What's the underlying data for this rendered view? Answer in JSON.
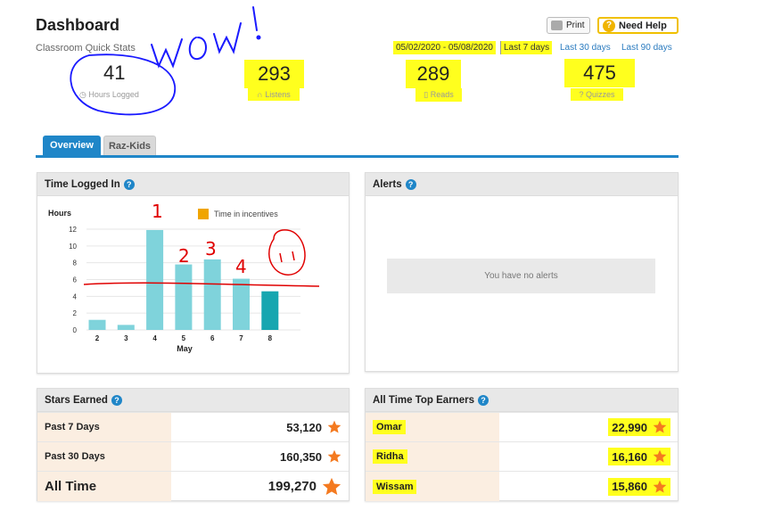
{
  "header": {
    "title": "Dashboard",
    "subtitle": "Classroom Quick Stats",
    "print_label": "Print",
    "help_label": "Need Help",
    "date_range": "05/02/2020 - 05/08/2020",
    "range_options": [
      "Last 7 days",
      "Last 30 days",
      "Last 90 days"
    ]
  },
  "stats": [
    {
      "value": "41",
      "label": "Hours Logged",
      "icon": "clock-icon"
    },
    {
      "value": "293",
      "label": "Listens",
      "icon": "headphones-icon"
    },
    {
      "value": "289",
      "label": "Reads",
      "icon": "book-icon"
    },
    {
      "value": "475",
      "label": "Quizzes",
      "icon": "question-icon"
    }
  ],
  "tabs": [
    "Overview",
    "Raz-Kids"
  ],
  "time_panel": {
    "title": "Time Logged In"
  },
  "chart_data": {
    "type": "bar",
    "ylabel": "Hours",
    "xlabel": "May",
    "categories": [
      "2",
      "3",
      "4",
      "5",
      "6",
      "7",
      "8"
    ],
    "values": [
      1.2,
      0.6,
      11.9,
      7.8,
      8.4,
      6.1,
      4.6
    ],
    "highlight_index": 6,
    "yticks": [
      0,
      2,
      4,
      6,
      8,
      10,
      12
    ],
    "ylim": [
      0,
      12
    ],
    "legend": "Time in incentives",
    "colors": {
      "bar": "#7fd3db",
      "highlight": "#17a6b0",
      "legend": "#f0a500"
    }
  },
  "annotations": {
    "wow_text": "WOW!",
    "bar_numbers": [
      "1",
      "2",
      "3",
      "4"
    ]
  },
  "alerts_panel": {
    "title": "Alerts",
    "empty_text": "You have no alerts"
  },
  "stars_panel": {
    "title": "Stars Earned",
    "rows": [
      {
        "label": "Past 7 Days",
        "value": "53,120"
      },
      {
        "label": "Past 30 Days",
        "value": "160,350"
      },
      {
        "label": "All Time",
        "value": "199,270"
      }
    ]
  },
  "earners_panel": {
    "title": "All Time Top Earners",
    "rows": [
      {
        "label": "Omar",
        "value": "22,990"
      },
      {
        "label": "Ridha",
        "value": "16,160"
      },
      {
        "label": "Wissam",
        "value": "15,860"
      }
    ]
  },
  "colors": {
    "accent": "#1f86c8",
    "highlight": "#ffff1e",
    "star": "#f47a20",
    "pen_blue": "#1a1aff",
    "pen_red": "#e00000"
  }
}
